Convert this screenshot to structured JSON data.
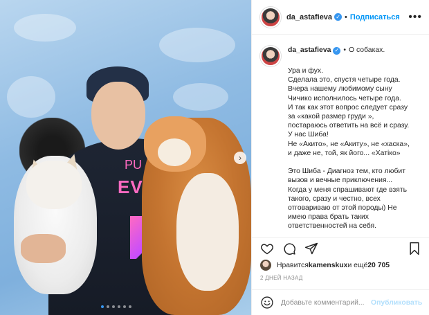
{
  "post": {
    "username": "da_astafieva",
    "header_separator": "•",
    "follow_label": "Подписаться",
    "more_label": "•••",
    "caption_tagline_sep": "•",
    "caption_tagline": "О собаках.",
    "caption_lines": [
      "Ура и фух.",
      "Сделала это, спустя четыре года.",
      "Вчера нашему любимому сыну",
      "Чичико исполнилось четыре года.",
      "И так как этот вопрос следует сразу",
      "за «какой размер груди »,",
      "постараюсь ответить на всё и сразу.",
      "У нас Шиба!",
      "Не «Акито», не «Акиту», не «хаска»,",
      "и даже не, той, як його... «Хатіко»",
      "",
      "Это Шиба - Диагноз тем, кто любит",
      "вызов и вечные приключения...",
      "Когда у меня спрашивают где взять",
      "такого, сразу и честно, всех",
      "отговариваю от этой породы) Не",
      "имею права брать таких",
      "ответственностей на себя."
    ],
    "likes_prefix": "Нравится ",
    "likes_user": "kamenskux",
    "likes_middle": " и ещё ",
    "likes_count": "20 705",
    "date": "2 ДНЕЙ НАЗАД",
    "comment_placeholder": "Добавьте комментарий...",
    "publish_label": "Опубликовать",
    "photo_print_top": "PU",
    "photo_print_main": "EVE",
    "carousel_next_glyph": "›",
    "carousel_total": 6,
    "carousel_active": 1
  },
  "colors": {
    "link_blue": "#0095f6",
    "publish_disabled": "#b2dffc",
    "muted": "#8e8e8e"
  },
  "icons": [
    "verified-badge-icon",
    "more-options-icon",
    "heart-icon",
    "comment-icon",
    "share-icon",
    "bookmark-icon",
    "emoji-icon",
    "chevron-right-icon"
  ]
}
